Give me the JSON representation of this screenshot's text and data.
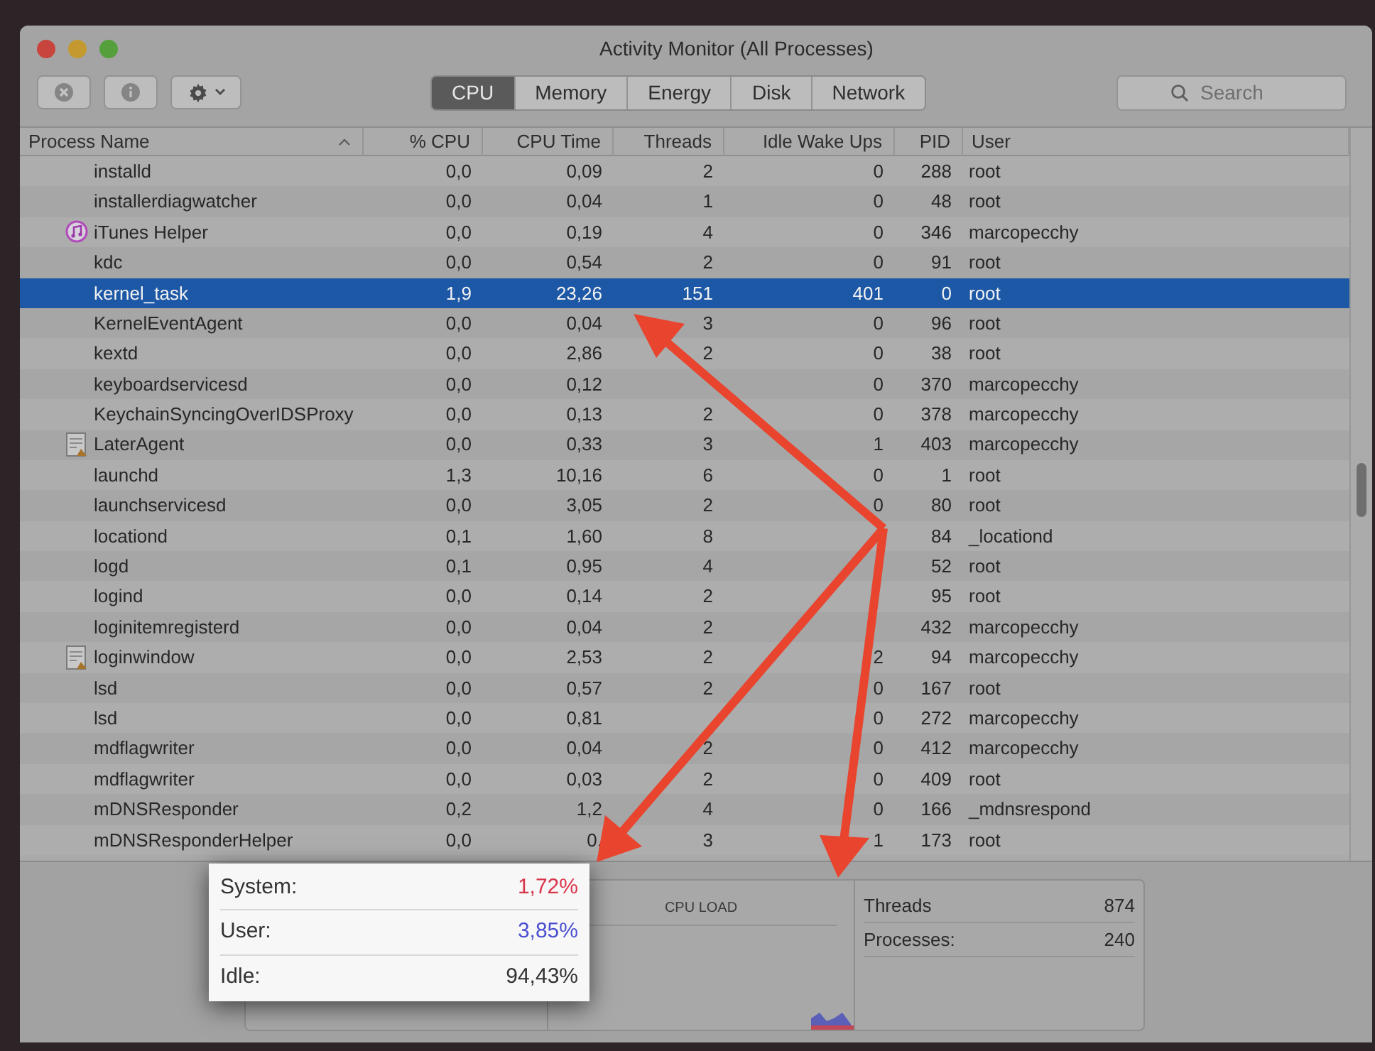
{
  "window": {
    "title": "Activity Monitor (All Processes)"
  },
  "tabs": [
    {
      "label": "CPU",
      "selected": true
    },
    {
      "label": "Memory",
      "selected": false
    },
    {
      "label": "Energy",
      "selected": false
    },
    {
      "label": "Disk",
      "selected": false
    },
    {
      "label": "Network",
      "selected": false
    }
  ],
  "search": {
    "placeholder": "Search"
  },
  "table": {
    "columns": [
      "Process Name",
      "% CPU",
      "CPU Time",
      "Threads",
      "Idle Wake Ups",
      "PID",
      "User"
    ],
    "rows": [
      {
        "kind": "plain",
        "selected": false,
        "name": "installd",
        "cpu": "0,0",
        "cpu_time": "0,09",
        "threads": "2",
        "idle_wake_ups": "0",
        "pid": "288",
        "user": "root"
      },
      {
        "kind": "plain",
        "selected": false,
        "name": "installerdiagwatcher",
        "cpu": "0,0",
        "cpu_time": "0,04",
        "threads": "1",
        "idle_wake_ups": "0",
        "pid": "48",
        "user": "root"
      },
      {
        "kind": "music",
        "selected": false,
        "name": "iTunes Helper",
        "cpu": "0,0",
        "cpu_time": "0,19",
        "threads": "4",
        "idle_wake_ups": "0",
        "pid": "346",
        "user": "marcopecchy"
      },
      {
        "kind": "plain",
        "selected": false,
        "name": "kdc",
        "cpu": "0,0",
        "cpu_time": "0,54",
        "threads": "2",
        "idle_wake_ups": "0",
        "pid": "91",
        "user": "root"
      },
      {
        "kind": "plain",
        "selected": true,
        "name": "kernel_task",
        "cpu": "1,9",
        "cpu_time": "23,26",
        "threads": "151",
        "idle_wake_ups": "401",
        "pid": "0",
        "user": "root"
      },
      {
        "kind": "plain",
        "selected": false,
        "name": "KernelEventAgent",
        "cpu": "0,0",
        "cpu_time": "0,04",
        "threads": "3",
        "idle_wake_ups": "0",
        "pid": "96",
        "user": "root"
      },
      {
        "kind": "plain",
        "selected": false,
        "name": "kextd",
        "cpu": "0,0",
        "cpu_time": "2,86",
        "threads": "2",
        "idle_wake_ups": "0",
        "pid": "38",
        "user": "root"
      },
      {
        "kind": "plain",
        "selected": false,
        "name": "keyboardservicesd",
        "cpu": "0,0",
        "cpu_time": "0,12",
        "idle_wake_ups": "0",
        "pid": "370",
        "user": "marcopecchy"
      },
      {
        "kind": "plain",
        "selected": false,
        "name": "KeychainSyncingOverIDSProxy",
        "cpu": "0,0",
        "cpu_time": "0,13",
        "threads": "2",
        "idle_wake_ups": "0",
        "pid": "378",
        "user": "marcopecchy"
      },
      {
        "kind": "document",
        "selected": false,
        "name": "LaterAgent",
        "cpu": "0,0",
        "cpu_time": "0,33",
        "threads": "3",
        "idle_wake_ups": "1",
        "pid": "403",
        "user": "marcopecchy"
      },
      {
        "kind": "plain",
        "selected": false,
        "name": "launchd",
        "cpu": "1,3",
        "cpu_time": "10,16",
        "threads": "6",
        "idle_wake_ups": "0",
        "pid": "1",
        "user": "root"
      },
      {
        "kind": "plain",
        "selected": false,
        "name": "launchservicesd",
        "cpu": "0,0",
        "cpu_time": "3,05",
        "threads": "2",
        "idle_wake_ups": "0",
        "pid": "80",
        "user": "root"
      },
      {
        "kind": "plain",
        "selected": false,
        "name": "locationd",
        "cpu": "0,1",
        "cpu_time": "1,60",
        "threads": "8",
        "pid": "84",
        "user": "_locationd"
      },
      {
        "kind": "plain",
        "selected": false,
        "name": "logd",
        "cpu": "0,1",
        "cpu_time": "0,95",
        "threads": "4",
        "pid": "52",
        "user": "root"
      },
      {
        "kind": "plain",
        "selected": false,
        "name": "logind",
        "cpu": "0,0",
        "cpu_time": "0,14",
        "threads": "2",
        "pid": "95",
        "user": "root"
      },
      {
        "kind": "plain",
        "selected": false,
        "name": "loginitemregisterd",
        "cpu": "0,0",
        "cpu_time": "0,04",
        "threads": "2",
        "pid": "432",
        "user": "marcopecchy"
      },
      {
        "kind": "document",
        "selected": false,
        "name": "loginwindow",
        "cpu": "0,0",
        "cpu_time": "2,53",
        "threads": "2",
        "idle_wake_ups": "2",
        "pid": "94",
        "user": "marcopecchy"
      },
      {
        "kind": "plain",
        "selected": false,
        "name": "lsd",
        "cpu": "0,0",
        "cpu_time": "0,57",
        "threads": "2",
        "idle_wake_ups": "0",
        "pid": "167",
        "user": "root"
      },
      {
        "kind": "plain",
        "selected": false,
        "name": "lsd",
        "cpu": "0,0",
        "cpu_time": "0,81",
        "idle_wake_ups": "0",
        "pid": "272",
        "user": "marcopecchy"
      },
      {
        "kind": "plain",
        "selected": false,
        "name": "mdflagwriter",
        "cpu": "0,0",
        "cpu_time": "0,04",
        "threads": "2",
        "idle_wake_ups": "0",
        "pid": "412",
        "user": "marcopecchy"
      },
      {
        "kind": "plain",
        "selected": false,
        "name": "mdflagwriter",
        "cpu": "0,0",
        "cpu_time": "0,03",
        "threads": "2",
        "idle_wake_ups": "0",
        "pid": "409",
        "user": "root"
      },
      {
        "kind": "plain",
        "selected": false,
        "name": "mDNSResponder",
        "cpu": "0,2",
        "cpu_time": "1,2",
        "threads": "4",
        "idle_wake_ups": "0",
        "pid": "166",
        "user": "_mdnsrespond"
      },
      {
        "kind": "plain",
        "selected": false,
        "name": "mDNSResponderHelper",
        "cpu": "0,0",
        "cpu_time": "0,",
        "threads": "3",
        "idle_wake_ups": "1",
        "pid": "173",
        "user": "root"
      }
    ]
  },
  "cpu_stats": [
    {
      "label": "System:",
      "value": "1,72%",
      "color": "#d9354a"
    },
    {
      "label": "User:",
      "value": "3,85%",
      "color": "#4b4fd0"
    },
    {
      "label": "Idle:",
      "value": "94,43%",
      "color": "#333333"
    }
  ],
  "cpu_load": {
    "title": "CPU LOAD"
  },
  "counts": [
    {
      "label": "Threads",
      "value": "874"
    },
    {
      "label": "Processes:",
      "value": "240"
    }
  ]
}
